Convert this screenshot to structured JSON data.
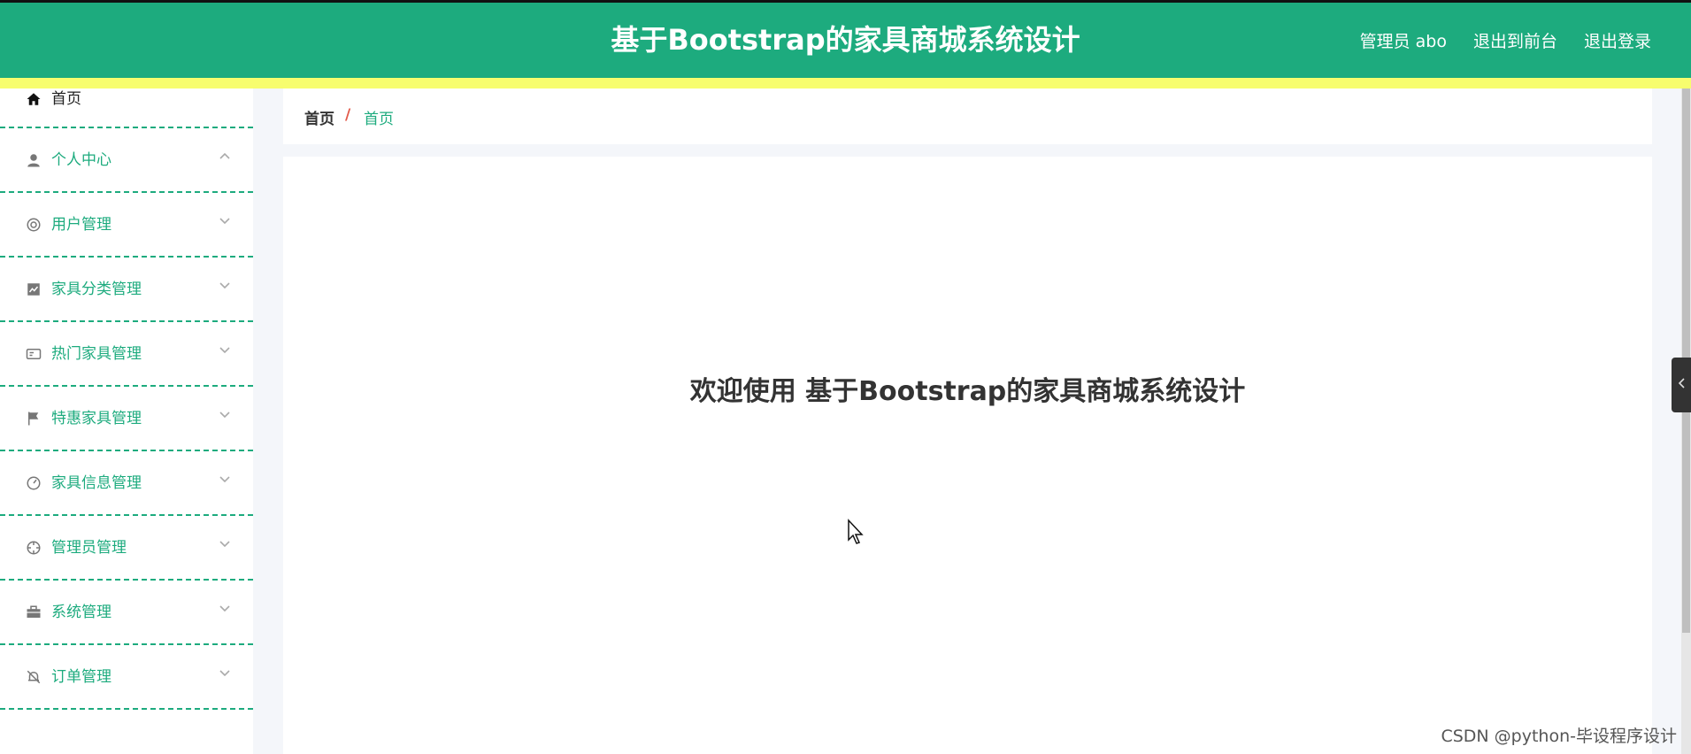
{
  "header": {
    "title": "基于Bootstrap的家具商城系统设计",
    "user": "管理员 abo",
    "to_front": "退出到前台",
    "logout": "退出登录",
    "bg_color": "#1dab7e",
    "strip_color": "#f7fd6e"
  },
  "sidebar": {
    "items": [
      {
        "label": "首页",
        "icon": "home-icon"
      },
      {
        "label": "个人中心",
        "icon": "user-icon",
        "expanded": true
      },
      {
        "label": "用户管理",
        "icon": "lifebuoy-icon"
      },
      {
        "label": "家具分类管理",
        "icon": "chart-icon"
      },
      {
        "label": "热门家具管理",
        "icon": "card-icon"
      },
      {
        "label": "特惠家具管理",
        "icon": "flag-icon"
      },
      {
        "label": "家具信息管理",
        "icon": "gauge-icon"
      },
      {
        "label": "管理员管理",
        "icon": "crosshair-icon"
      },
      {
        "label": "系统管理",
        "icon": "briefcase-icon"
      },
      {
        "label": "订单管理",
        "icon": "bell-off-icon"
      }
    ]
  },
  "breadcrumb": {
    "first": "首页",
    "separator": "/",
    "current": "首页"
  },
  "main": {
    "welcome": "欢迎使用 基于Bootstrap的家具商城系统设计"
  },
  "watermark": "CSDN @python-毕设程序设计"
}
